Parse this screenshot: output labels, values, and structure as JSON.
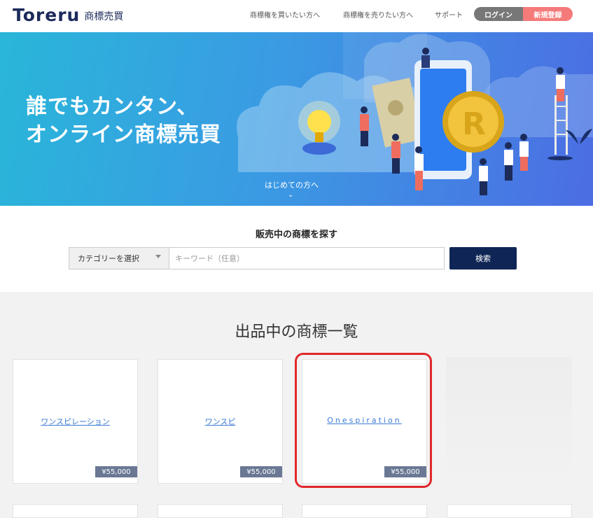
{
  "header": {
    "logo": "Toreru",
    "logo_sub": "商標売買",
    "nav": [
      "商標権を買いたい方へ",
      "商標権を売りたい方へ",
      "サポート"
    ],
    "login": "ログイン",
    "signup": "新規登録"
  },
  "hero": {
    "title_line1": "誰でもカンタン、",
    "title_line2": "オンライン商標売買",
    "link": "はじめての方へ",
    "chevron": "⌄"
  },
  "search": {
    "title": "販売中の商標を探す",
    "category_label": "カテゴリーを選択",
    "keyword_placeholder": "キーワード（任意）",
    "button": "検索"
  },
  "listing": {
    "title": "出品中の商標一覧",
    "items": [
      {
        "name": "ワンスピレーション",
        "price": "¥55,000"
      },
      {
        "name": "ワンスピ",
        "price": "¥55,000"
      },
      {
        "name": "Onespiration",
        "price": "¥55,000"
      }
    ]
  }
}
